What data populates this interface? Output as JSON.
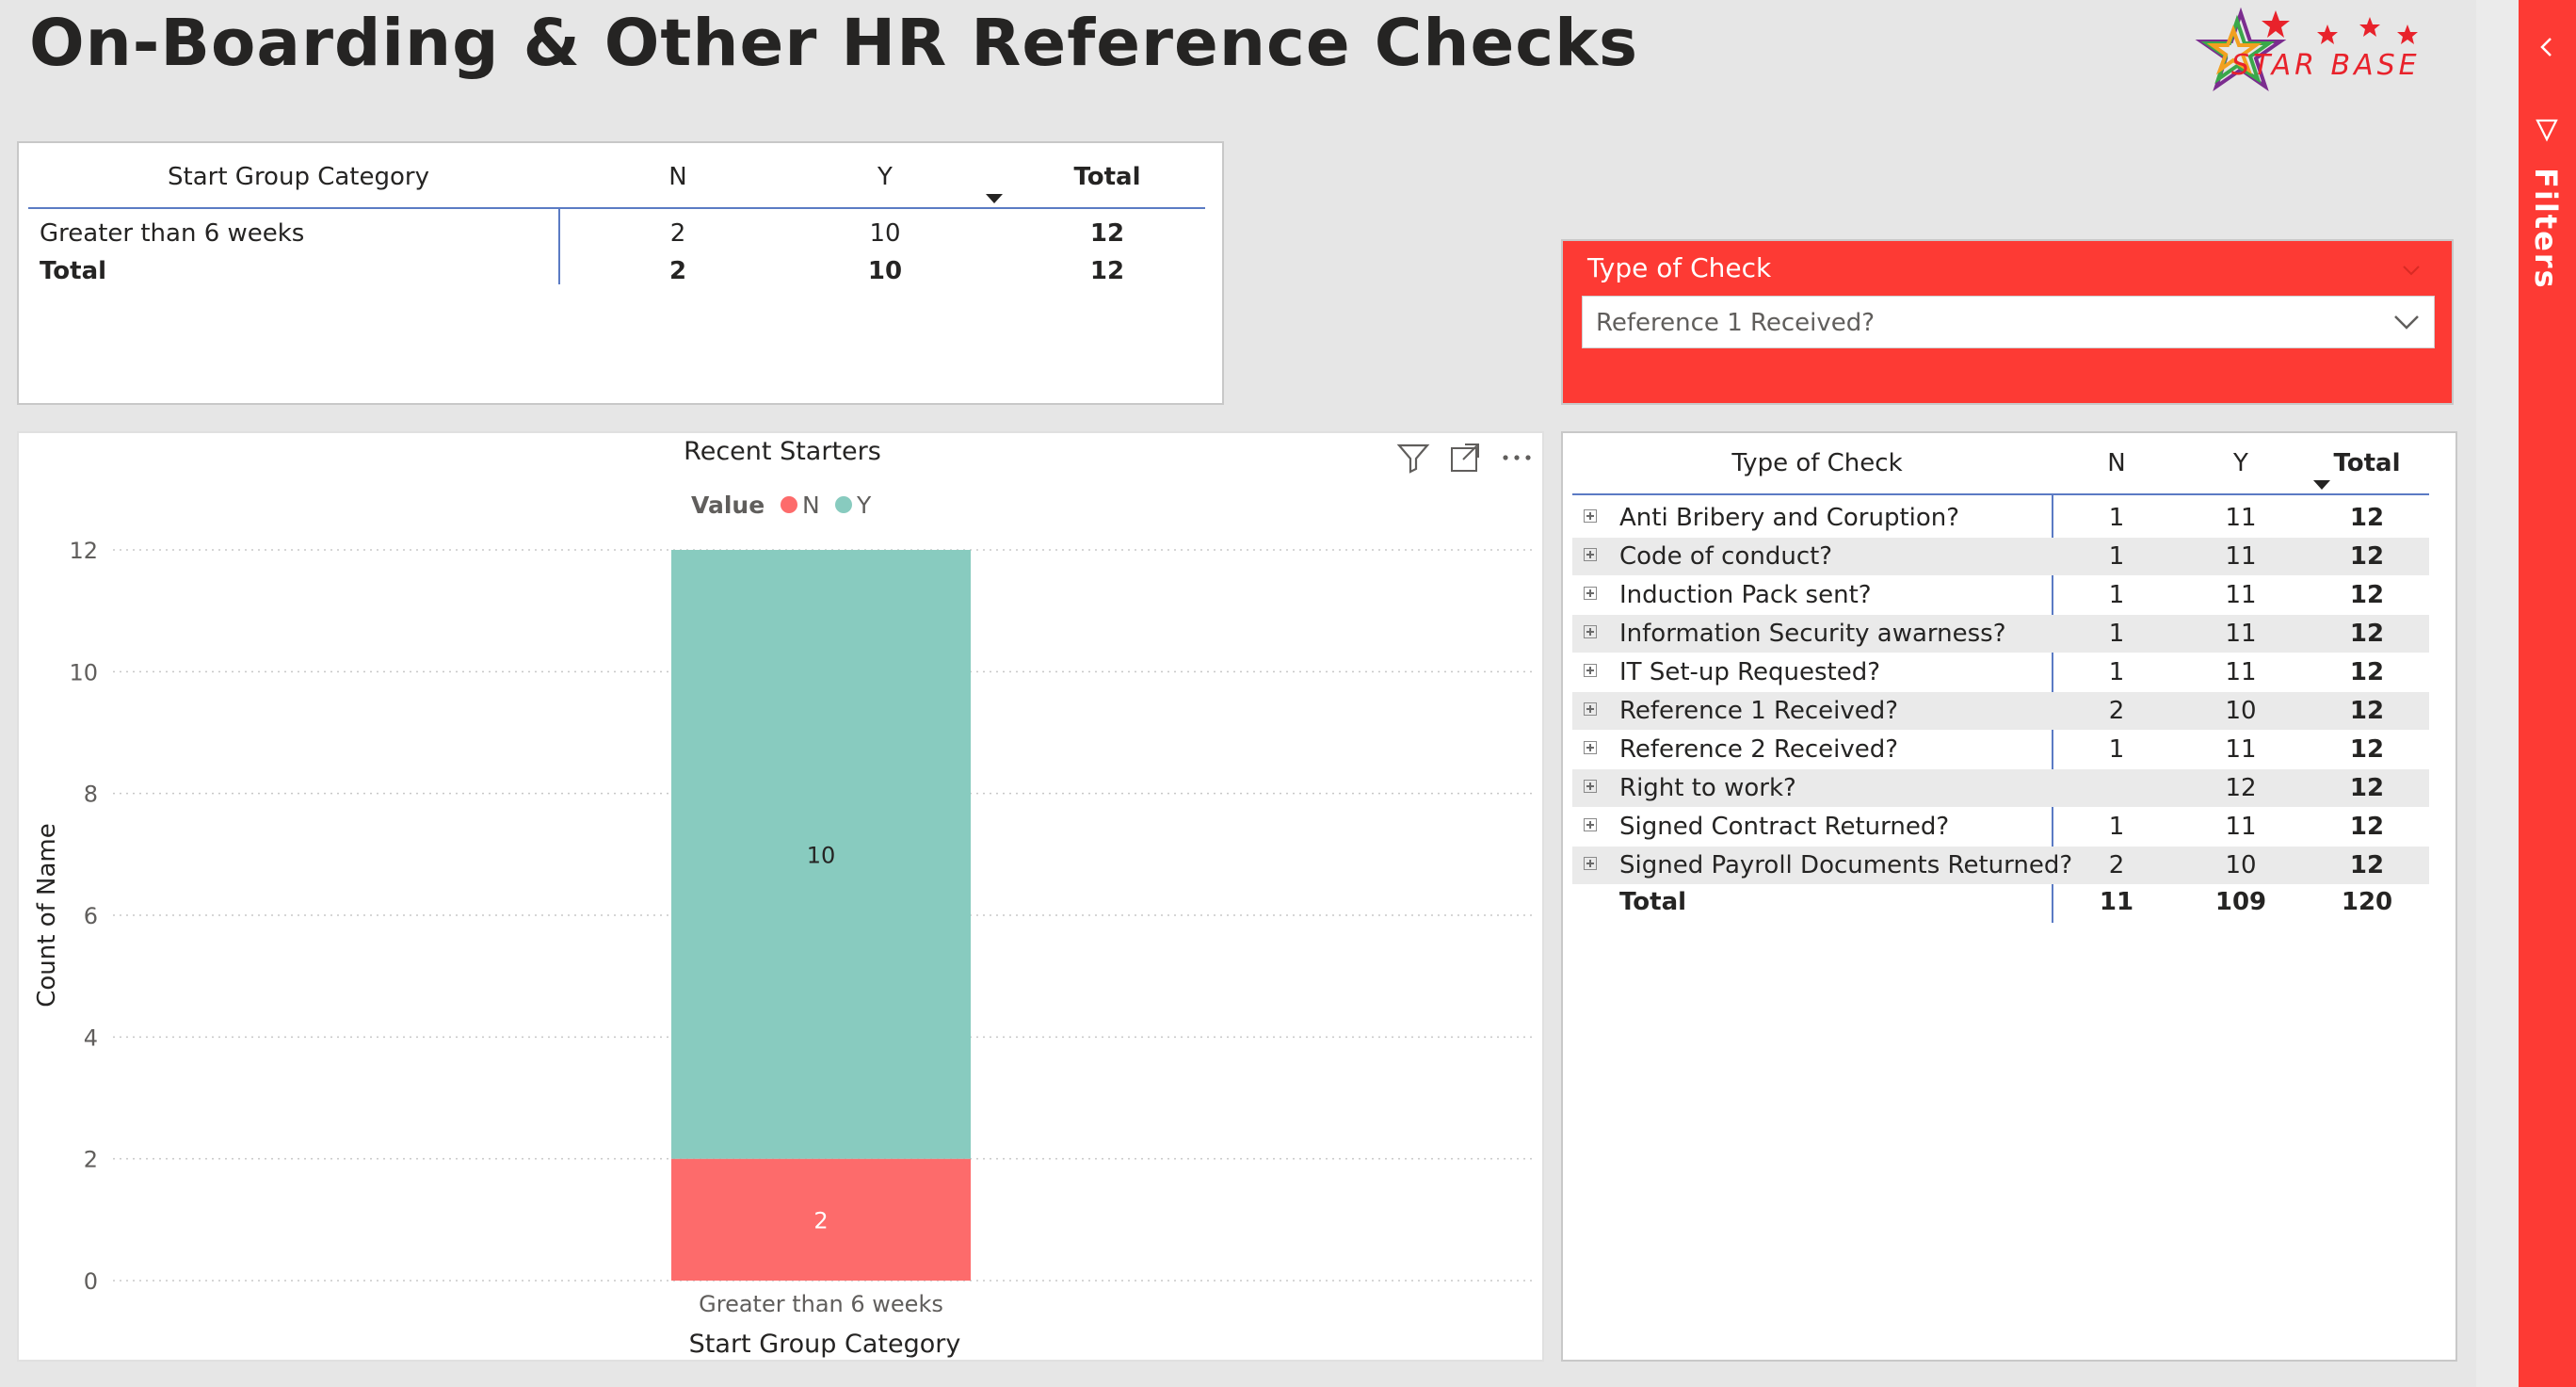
{
  "page": {
    "title": "On-Boarding & Other HR Reference Checks"
  },
  "logo": {
    "text": "STAR BASE"
  },
  "top_table": {
    "headers": [
      "Start Group Category",
      "N",
      "Y",
      "Total"
    ],
    "rows": [
      {
        "category": "Greater than 6 weeks",
        "n": "2",
        "y": "10",
        "total": "12"
      }
    ],
    "total_row": {
      "category": "Total",
      "n": "2",
      "y": "10",
      "total": "12"
    }
  },
  "slicer": {
    "title": "Type of Check",
    "selected": "Reference 1 Received?"
  },
  "check_table": {
    "headers": [
      "Type of Check",
      "N",
      "Y",
      "Total"
    ],
    "rows": [
      {
        "check": "Anti Bribery and Coruption?",
        "n": "1",
        "y": "11",
        "total": "12"
      },
      {
        "check": "Code of conduct?",
        "n": "1",
        "y": "11",
        "total": "12"
      },
      {
        "check": "Induction Pack sent?",
        "n": "1",
        "y": "11",
        "total": "12"
      },
      {
        "check": "Information Security awarness?",
        "n": "1",
        "y": "11",
        "total": "12"
      },
      {
        "check": "IT Set-up Requested?",
        "n": "1",
        "y": "11",
        "total": "12"
      },
      {
        "check": "Reference 1 Received?",
        "n": "2",
        "y": "10",
        "total": "12"
      },
      {
        "check": "Reference 2 Received?",
        "n": "1",
        "y": "11",
        "total": "12"
      },
      {
        "check": "Right to work?",
        "n": "",
        "y": "12",
        "total": "12"
      },
      {
        "check": "Signed Contract Returned?",
        "n": "1",
        "y": "11",
        "total": "12"
      },
      {
        "check": "Signed Payroll Documents Returned?",
        "n": "2",
        "y": "10",
        "total": "12"
      }
    ],
    "total_row": {
      "check": "Total",
      "n": "11",
      "y": "109",
      "total": "120"
    }
  },
  "filters_pane": {
    "label": "Filters"
  },
  "colors": {
    "accent": "#fd3a34",
    "series_n": "#fd6b6b",
    "series_y": "#88cbbf",
    "table_rule": "#5b7bc4"
  },
  "icons": [
    "filter-icon",
    "focus-mode-icon",
    "more-options-icon",
    "expand-icon",
    "chevron-down-icon",
    "chevron-left-icon",
    "filter-pane-icon"
  ],
  "chart_data": {
    "type": "bar",
    "stacked": true,
    "title": "Recent Starters",
    "legend_title": "Value",
    "legend_position": "top-center",
    "categories": [
      "Greater than 6 weeks"
    ],
    "series": [
      {
        "name": "N",
        "values": [
          2
        ],
        "color": "#fd6b6b"
      },
      {
        "name": "Y",
        "values": [
          10
        ],
        "color": "#88cbbf"
      }
    ],
    "xlabel": "Start Group Category",
    "ylabel": "Count of Name",
    "ylim": [
      0,
      12
    ],
    "yticks": [
      0,
      2,
      4,
      6,
      8,
      10,
      12
    ],
    "grid": true
  }
}
